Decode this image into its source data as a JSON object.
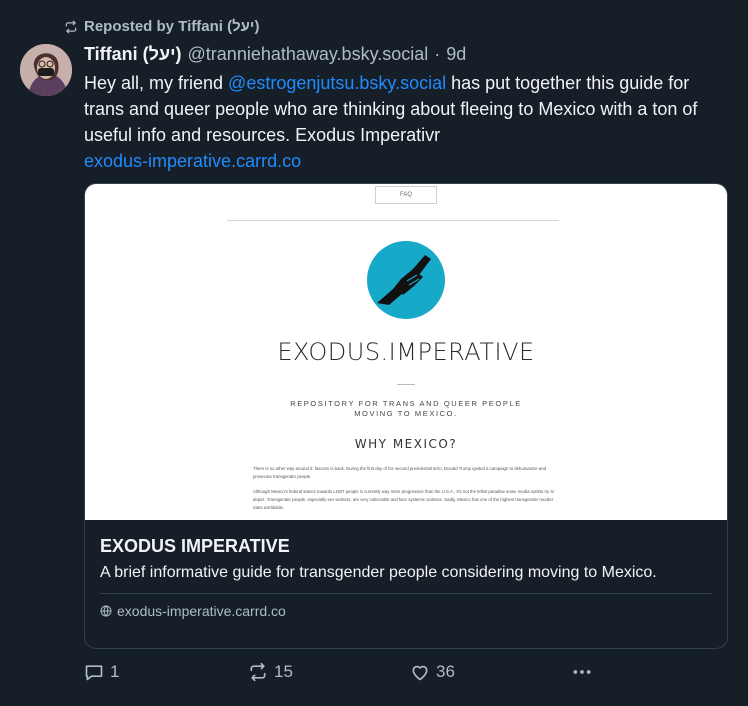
{
  "repost": {
    "label": "Reposted by Tiffani (יעל)"
  },
  "author": {
    "name": "Tiffani (יעל)",
    "handle": "@tranniehathaway.bsky.social",
    "separator": "·",
    "time": "9d"
  },
  "post": {
    "text_1": "Hey all, my friend ",
    "mention": "@estrogenjutsu.bsky.social",
    "text_2": " has put together this guide for trans and queer people who are thinking about fleeing to Mexico with a ton of useful info and resources.  Exodus Imperativr",
    "link": "exodus-imperative.carrd.co"
  },
  "embed": {
    "thumbnail": {
      "faq_label": "FAQ",
      "site_title": "EXODUS.IMPERATIVE",
      "tagline": "REPOSITORY FOR TRANS AND QUEER PEOPLE MOVING TO MEXICO.",
      "heading": "WHY MEXICO?",
      "para_1": "There is no other way around it: fascism is back. During the first day of his second presidential term, Donald Trump ignited a campaign to dehumanize and prosecute transgender people.",
      "para_2": "Although Mexico's federal stance towards LGBT people is currently way more progressive than the U.S.A., it's not the leftist paradise some media outlets try to depict. Transgender people, especially sex workers, are very vulnerable and face systemic violence. Sadly, Mexico has one of the highest transgender murder rates worldwide."
    },
    "title": "EXODUS IMPERATIVE",
    "description": "A brief informative guide for transgender people considering moving to Mexico.",
    "domain": "exodus-imperative.carrd.co"
  },
  "actions": {
    "replies": "1",
    "reposts": "15",
    "likes": "36"
  },
  "colors": {
    "background": "#161e27",
    "link": "#208bfe",
    "muted": "#aebbc9",
    "logo_teal": "#17a9c8"
  }
}
